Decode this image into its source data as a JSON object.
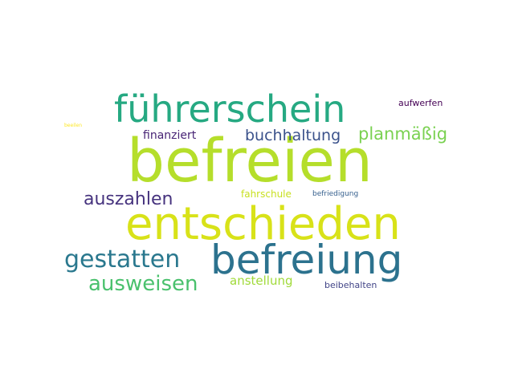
{
  "words": [
    {
      "text": "befreien",
      "color": "#b5de2b"
    },
    {
      "text": "entschieden",
      "color": "#d8e219"
    },
    {
      "text": "befreiung",
      "color": "#2c728e"
    },
    {
      "text": "führerschein",
      "color": "#26a982"
    },
    {
      "text": "gestatten",
      "color": "#2a788e"
    },
    {
      "text": "ausweisen",
      "color": "#4ac16d"
    },
    {
      "text": "auszahlen",
      "color": "#46337e"
    },
    {
      "text": "planmäßig",
      "color": "#7ad151"
    },
    {
      "text": "buchhaltung",
      "color": "#3b528b"
    },
    {
      "text": "anstellung",
      "color": "#a0da39"
    },
    {
      "text": "finanziert",
      "color": "#482475"
    },
    {
      "text": "fahrschule",
      "color": "#c8e020"
    },
    {
      "text": "beibehalten",
      "color": "#414487"
    },
    {
      "text": "aufwerfen",
      "color": "#440154"
    },
    {
      "text": "befriedigung",
      "color": "#355f8d"
    },
    {
      "text": "beeilen",
      "color": "#fde725"
    }
  ]
}
